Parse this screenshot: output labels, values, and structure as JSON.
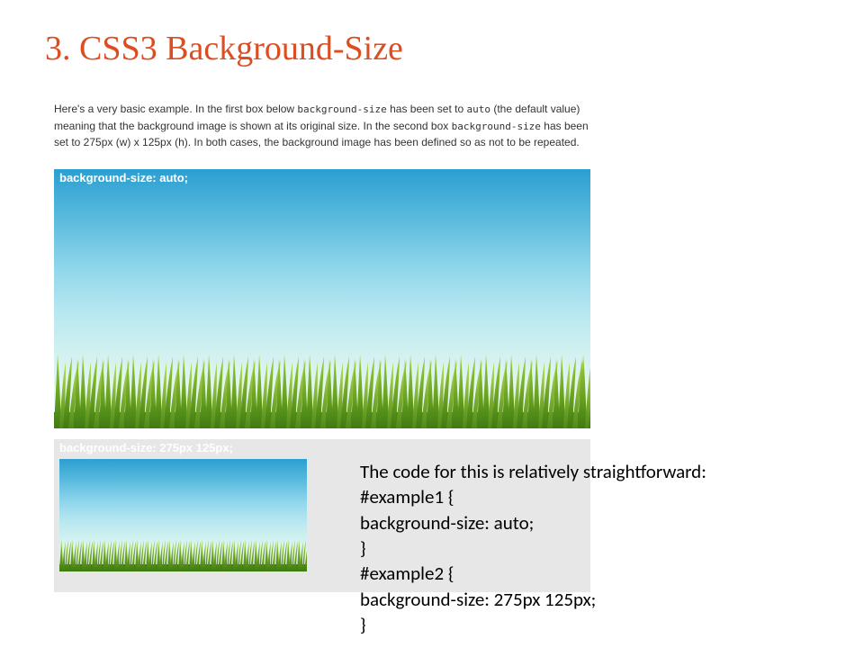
{
  "title": "3. CSS3 Background-Size",
  "intro": {
    "part1": "Here's a very basic example. In the first box below ",
    "code1": "background-size",
    "part2": " has been set to ",
    "code2": "auto",
    "part3": " (the default value) meaning that the background image is shown at its original size. In the second box ",
    "code3": "background-size",
    "part4": " has been set to 275px (w) x 125px (h). In both cases, the background image has been defined so as not to be repeated."
  },
  "example1": {
    "label": "background-size: auto;"
  },
  "example2": {
    "label": "background-size: 275px 125px;"
  },
  "code": {
    "line1": "The code for this is relatively straightforward:",
    "line2": "#example1 {",
    "line3": "background-size: auto;",
    "line4": "}",
    "line5": "#example2 {",
    "line6": "background-size: 275px 125px;",
    "line7": "}"
  }
}
